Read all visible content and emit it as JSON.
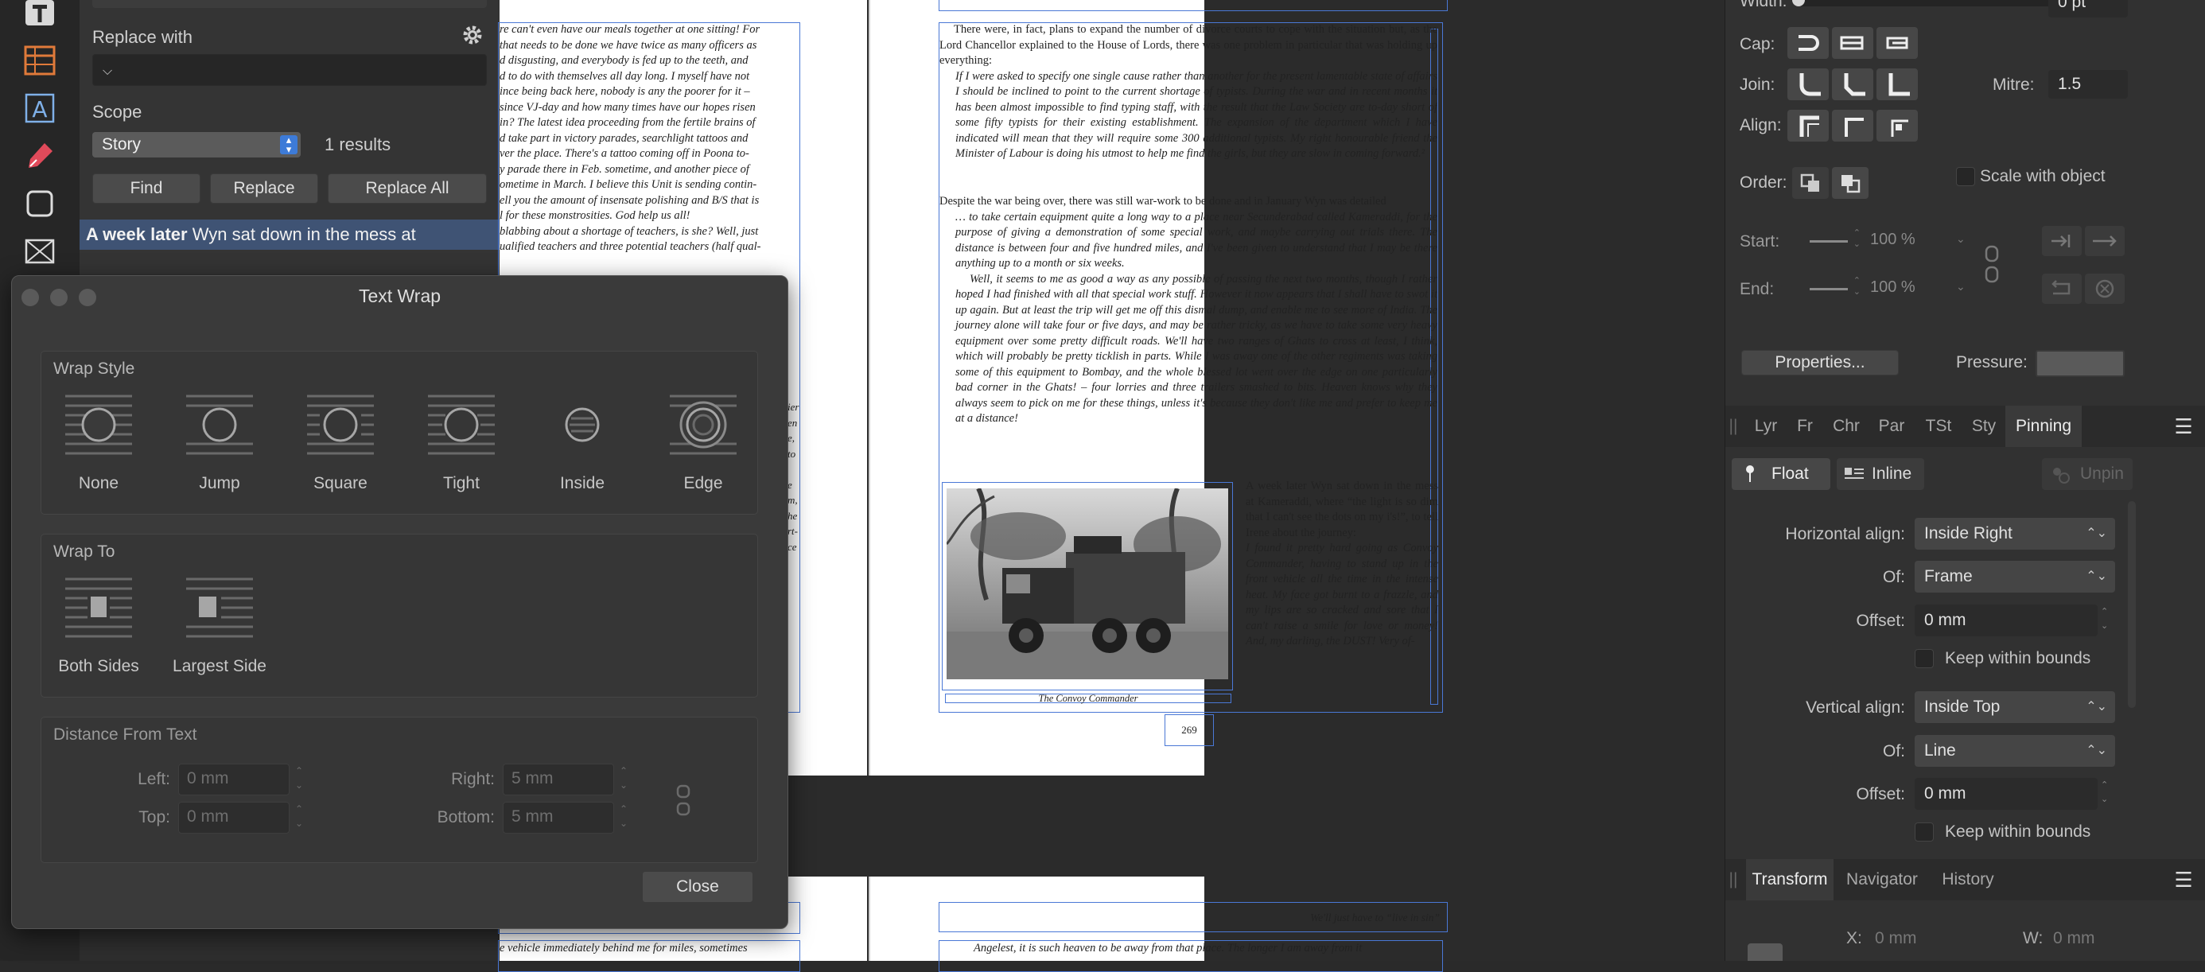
{
  "find_replace": {
    "replace_label": "Replace with",
    "replace_value": "",
    "scope_label": "Scope",
    "scope_value": "Story",
    "results": "1 results",
    "find_button": "Find",
    "replace_button": "Replace",
    "replace_all_button": "Replace All",
    "result_bold": "A week later",
    "result_text": " Wyn sat down in the mess at"
  },
  "text_wrap": {
    "title": "Text Wrap",
    "wrap_style_label": "Wrap Style",
    "styles": [
      "None",
      "Jump",
      "Square",
      "Tight",
      "Inside",
      "Edge"
    ],
    "wrap_to_label": "Wrap To",
    "wrap_to": [
      "Both Sides",
      "Largest Side"
    ],
    "distance_label": "Distance From Text",
    "left_label": "Left:",
    "left_value": "0 mm",
    "right_label": "Right:",
    "right_value": "5 mm",
    "top_label": "Top:",
    "top_value": "0 mm",
    "bottom_label": "Bottom:",
    "bottom_value": "5 mm",
    "close_button": "Close"
  },
  "document": {
    "left_col": [
      "re can't even have our meals together at one sitting! For",
      "that needs to be done we have twice as many officers as",
      "d disgusting, and everybody is fed up to the teeth, and",
      "d to do with themselves all day long. I myself have not",
      "ince being back here, nobody is any the poorer for it –",
      "",
      "since VJ-day and how many times have our hopes risen",
      "in? The latest idea proceeding from the fertile brains of",
      "d take part in victory parades, searchlight tattoos and",
      "ver the place. There's a tattoo coming off in Poona to-",
      "y parade there in Feb. sometime, and another piece of",
      "ometime in March. I believe this Unit is sending contin-",
      "ell you the amount of insensate polishing and B/S that is",
      "l for these monstrosities. God help us all!",
      "blabbing about a shortage of teachers, is she? Well, just",
      "ualified teachers and three potential teachers (half qual-"
    ],
    "left_frag": [
      "ier",
      "en",
      "e,",
      "to",
      "",
      "e",
      "m,",
      "he",
      "rt-",
      "ce"
    ],
    "para1": "There were, in fact, plans to expand the number of divorce courts to cope with the situation but, as the Lord Chancellor explained to the House of Lords, there was one problem in particular that was holding up everything:",
    "quote1": "If I were asked to specify one single cause rather than another for the present lamentable state of affairs I should be inclined to point to the current shortage of typists. During the war and in recent months it has been almost impossible to find typing staff, with the result that the Law Society are to-day short of some fifty typists for their existing establishment. The expansion of the department which I have indicated will mean that they will require some 300 additional typists. My right honourable friend the Minister of Labour is doing his utmost to help me find the girls, but they are slow in coming forward.²",
    "para2": "Despite the war being over, there was still war-work to be done and in January Wyn was detailed",
    "quote2": "… to take certain equipment quite a long way to a place near Secunderabad called Kameraddi, for the purpose of giving a demonstration of some special work, and maybe carrying out trials there. The distance is between four and five hundred miles, and I've been given to understand that I may be there anything up to a month or six weeks.",
    "quote3": "Well, it seems to me as good a way as any possible of passing the next two months, though I rather hoped I had finished with all that special work stuff. However it now appears that I shall have to swot it up again. But at least the trip will get me off this dismal dump, and enable me to see more of India. The journey alone will take four or five days, and may be rather tricky, as we have to take some very heavy equipment over some pretty difficult roads. We'll have two ranges of Ghats to cross at least, I think, which will probably be pretty ticklish in parts. While I was away one of the other regiments was taking some of this equipment to Bombay, and the whole blessed lot went over the edge on one particularly bad corner in the Ghats! – four lorries and three trailers smashed to bits. Heaven knows why they always seem to pick on me for these things, unless it's because they don't like me and prefer to keep me at a distance!",
    "side_text": "A week later Wyn sat down in the mess at Kameraddi, where “the light is so dim that I can't see the dots on my i's!”, to tell Irene about the journey:",
    "side_quote": "I found it pretty hard going as Convoy Commander, having to stand up in the front vehicle all the time in the intense heat. My face got burnt to a frazzle, and my lips are so cracked and sore that I can't raise a smile for love or money! And, my darling, the DUST! Very of-",
    "caption": "The Convoy Commander",
    "page_number": "269",
    "next_header": "We'll just have to “live in sin”",
    "next_left": "e vehicle immediately behind me for miles, sometimes",
    "next_right": "Angelest, it is such heaven to be away from that place. The longer I am away from it",
    "top_header": "…"
  },
  "right_panel": {
    "width_label": "Width:",
    "width_value": "0 pt",
    "cap_label": "Cap:",
    "join_label": "Join:",
    "mitre_label": "Mitre:",
    "mitre_value": "1.5",
    "align_label": "Align:",
    "order_label": "Order:",
    "scale_label": "Scale with object",
    "start_label": "Start:",
    "start_pct": "100 %",
    "end_label": "End:",
    "end_pct": "100 %",
    "properties_button": "Properties...",
    "pressure_label": "Pressure:",
    "tabs": [
      "Lyr",
      "Fr",
      "Chr",
      "Par",
      "TSt",
      "Sty",
      "Pinning"
    ],
    "float_label": "Float",
    "inline_label": "Inline",
    "unpin_label": "Unpin",
    "h_align_label": "Horizontal align:",
    "h_align_value": "Inside Right",
    "of1_label": "Of:",
    "of1_value": "Frame",
    "offset1_label": "Offset:",
    "offset1_value": "0 mm",
    "keep1_label": "Keep within bounds",
    "v_align_label": "Vertical align:",
    "v_align_value": "Inside Top",
    "of2_label": "Of:",
    "of2_value": "Line",
    "offset2_label": "Offset:",
    "offset2_value": "0 mm",
    "keep2_label": "Keep within bounds",
    "bottom_tabs": [
      "Transform",
      "Navigator",
      "History"
    ],
    "x_label": "X:",
    "x_value": "0 mm",
    "w_label": "W:",
    "w_value": "0 mm"
  }
}
